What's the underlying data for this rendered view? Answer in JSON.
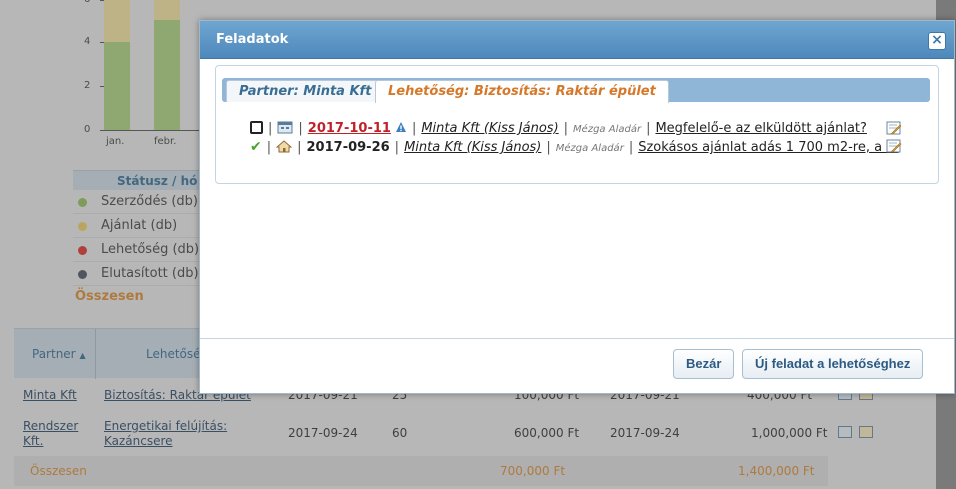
{
  "background": {
    "chart": {
      "y_ticks": [
        "6",
        "4",
        "2",
        "0"
      ],
      "x_labels": [
        "jan.",
        "febr."
      ]
    },
    "status_table": {
      "header": "Státusz / hó",
      "rows": [
        {
          "label": "Szerződés (db)",
          "color": "#8fba5a"
        },
        {
          "label": "Ajánlat (db)",
          "color": "#e8c963"
        },
        {
          "label": "Lehetőség (db)",
          "color": "#d8342f"
        },
        {
          "label": "Elutasított (db)",
          "color": "#4a5463"
        }
      ],
      "total_label": "Összesen"
    },
    "data_table": {
      "columns": [
        "Partner",
        "Lehetősé"
      ],
      "rows": [
        {
          "partner": "Minta Kft",
          "opportunity": "Biztosítás: Raktár épület",
          "date1": "2017-09-21",
          "qty": "25",
          "amount1": "100,000 Ft",
          "date2": "2017-09-21",
          "amount2": "400,000 Ft"
        },
        {
          "partner_line1": "Rendszer",
          "partner_line2": "Kft.",
          "opp_line1": "Energetikai felújítás:",
          "opp_line2": "Kazáncsere",
          "date1": "2017-09-24",
          "qty": "60",
          "amount1": "600,000 Ft",
          "date2": "2017-09-24",
          "amount2": "1,000,000 Ft"
        }
      ],
      "total_label": "Összesen",
      "total_amount1": "700,000 Ft",
      "total_amount2": "1,400,000 Ft"
    }
  },
  "dialog": {
    "title": "Feladatok",
    "close_symbol": "×",
    "tabs": [
      {
        "label": "Partner: Minta Kft"
      },
      {
        "label": "Lehetőség: Biztosítás: Raktár épület",
        "active": true
      }
    ],
    "separator": "|",
    "tasks": [
      {
        "status": "open",
        "kind_icon": "calendar-icon",
        "date": "2017-10-11",
        "overdue": true,
        "warning_icon": "info-warning-icon",
        "partner": "Minta Kft (Kiss János)",
        "owner": "Mézga Aladár",
        "subject": "Megfelelő-e az elküldött ajánlat?",
        "check_symbol": ""
      },
      {
        "status": "done",
        "kind_icon": "house-icon",
        "date": "2017-09-26",
        "overdue": false,
        "partner": "Minta Kft (Kiss János)",
        "owner": "Mézga Aladár",
        "subject": "Szokásos ajánlat adás 1 700 m2-re, a ...",
        "check_symbol": "✔"
      }
    ],
    "buttons": {
      "close": "Bezár",
      "new_task": "Új feladat a lehetőséghez"
    },
    "colors": {
      "titlebar": "#5b93c4",
      "overdue_date": "#c0222a",
      "active_tab": "#d6782a",
      "inactive_tab": "#3a6d93"
    }
  }
}
